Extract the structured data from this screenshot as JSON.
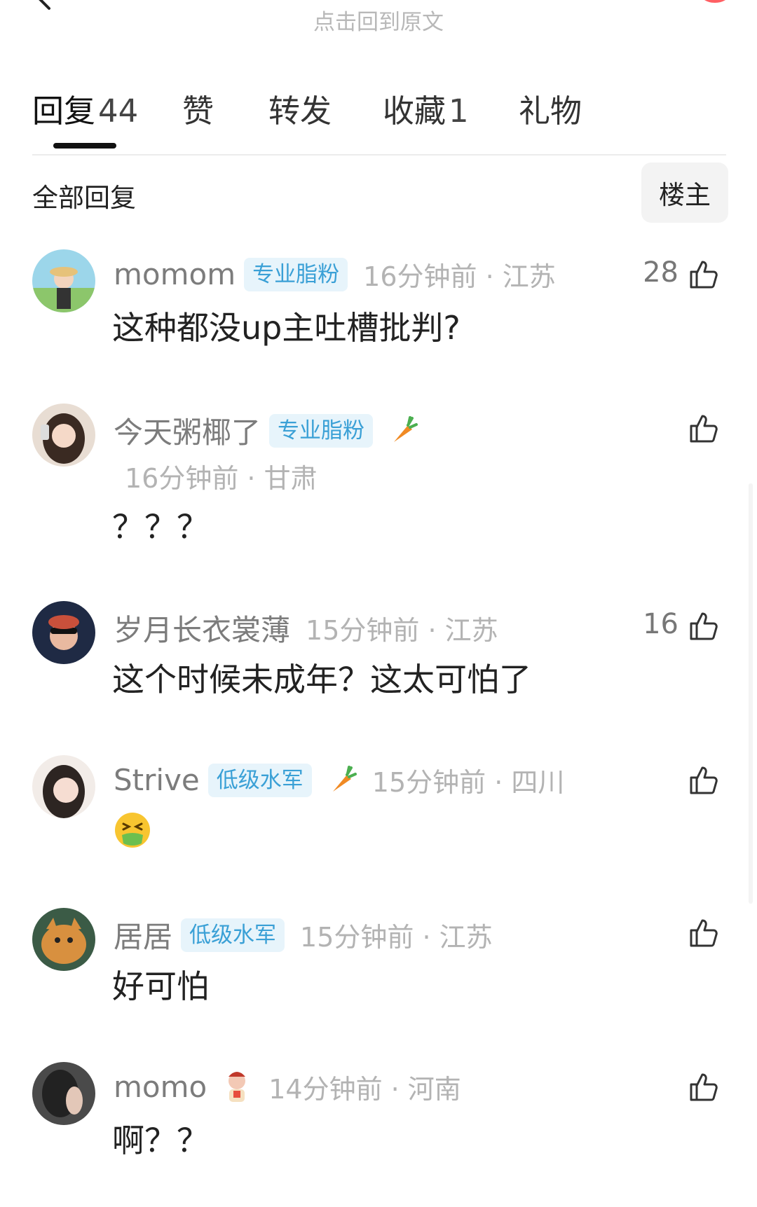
{
  "header": {
    "back_to_post": "点击回到原文"
  },
  "tabs": [
    {
      "label": "回复",
      "count": "44"
    },
    {
      "label": "赞",
      "count": ""
    },
    {
      "label": "转发",
      "count": ""
    },
    {
      "label": "收藏",
      "count": "1"
    },
    {
      "label": "礼物",
      "count": ""
    }
  ],
  "section": {
    "title": "全部回复",
    "owner_filter": "楼主"
  },
  "comments": [
    {
      "username": "momom",
      "badge": "专业脂粉",
      "time_location": "16分钟前 · 江苏",
      "text": "这种都没up主吐槽批判?",
      "likes": "28"
    },
    {
      "username": "今天粥椰了",
      "badge": "专业脂粉",
      "time_location": "16分钟前 · 甘肃",
      "text": "？？？",
      "likes": ""
    },
    {
      "username": "岁月长衣裳薄",
      "badge": "",
      "time_location": "15分钟前 · 江苏",
      "text": "这个时候未成年？这太可怕了",
      "likes": "16"
    },
    {
      "username": "Strive",
      "badge": "低级水军",
      "time_location": "15分钟前 · 四川",
      "text": "",
      "likes": ""
    },
    {
      "username": "居居",
      "badge": "低级水军",
      "time_location": "15分钟前 · 江苏",
      "text": "好可怕",
      "likes": ""
    },
    {
      "username": "momo",
      "badge": "",
      "time_location": "14分钟前 · 河南",
      "text": "啊？？",
      "likes": ""
    }
  ],
  "icons": {
    "like": "thumbs-up-icon",
    "badge_extra": "carrot-icon",
    "emoji": "nauseated-face-icon",
    "back": "chevron-left-icon"
  },
  "colors": {
    "badge_bg": "#e7f4fb",
    "badge_text": "#3aa0d6",
    "meta_gray": "#b3b3b3"
  }
}
